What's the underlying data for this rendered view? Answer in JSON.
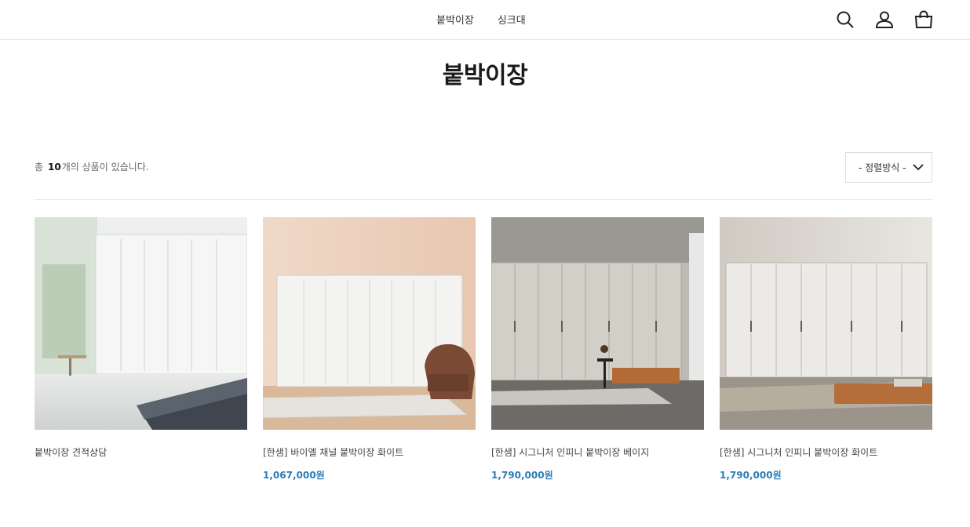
{
  "header": {
    "nav": [
      "붙박이장",
      "싱크대"
    ],
    "icons": [
      "search-icon",
      "user-icon",
      "shopping-bag-icon"
    ]
  },
  "page": {
    "title": "붙박이장",
    "count_prefix": "총",
    "count_value": "10",
    "count_suffix": "개의 상품이 있습니다.",
    "sort_label": "- 정렬방식 -"
  },
  "products": [
    {
      "name": "붙박이장 견적상담",
      "price": ""
    },
    {
      "name": "[한샘] 바이엘 채널 붙박이장 화이트",
      "price": "1,067,000원"
    },
    {
      "name": "[한샘] 시그니처 인피니 붙박이장 베이지",
      "price": "1,790,000원"
    },
    {
      "name": "[한샘] 시그니처 인피니 붙박이장 화이트",
      "price": "1,790,000원"
    }
  ],
  "colors": {
    "price": "#2a7db8",
    "divider": "#e8e8e8"
  }
}
